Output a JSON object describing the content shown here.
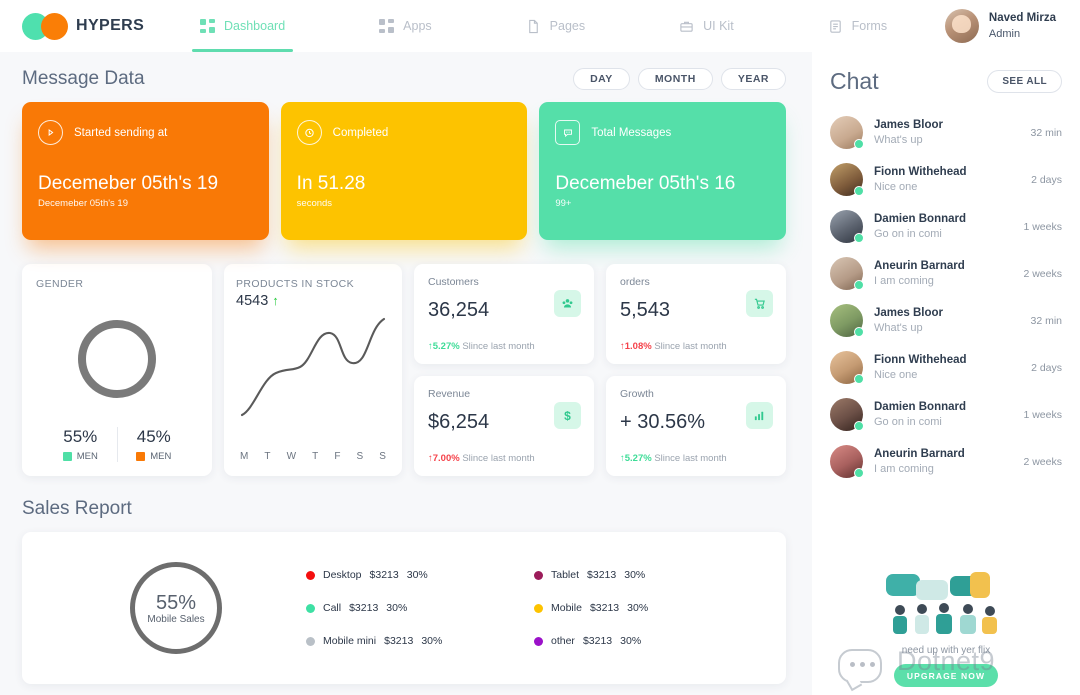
{
  "brand": {
    "name": "HYPERS"
  },
  "nav": {
    "items": [
      {
        "label": "Dashboard",
        "icon": "grid-icon",
        "active": true
      },
      {
        "label": "Apps",
        "icon": "apps-grid-icon",
        "active": false
      },
      {
        "label": "Pages",
        "icon": "page-icon",
        "active": false
      },
      {
        "label": "UI Kit",
        "icon": "briefcase-icon",
        "active": false
      },
      {
        "label": "Forms",
        "icon": "form-icon",
        "active": false
      }
    ]
  },
  "profile": {
    "name": "Naved Mirza",
    "role": "Admin"
  },
  "message_data": {
    "title": "Message Data",
    "range_buttons": [
      "DAY",
      "MONTH",
      "YEAR"
    ],
    "cards": [
      {
        "label": "Started sending at",
        "icon": "play-circle-icon",
        "value": "Decemeber 05th's 19",
        "sub": "Decemeber 05th's 19",
        "color": "#f97906"
      },
      {
        "label": "Completed",
        "icon": "clock-rewind-icon",
        "value": "In 51.28",
        "sub": "seconds",
        "color": "#fdc300"
      },
      {
        "label": "Total Messages",
        "icon": "chat-bubble-icon",
        "value": "Decemeber 05th's 16",
        "sub": "99+",
        "color": "#55dfa9"
      }
    ]
  },
  "gender": {
    "caption": "GENDER",
    "segments": [
      {
        "pct": "55%",
        "label": "MEN",
        "color": "#4fdfa6"
      },
      {
        "pct": "45%",
        "label": "MEN",
        "color": "#f97906"
      }
    ]
  },
  "stock": {
    "caption": "PRODUCTS IN STOCK",
    "value": "4543",
    "arrow": "↑",
    "days": [
      "M",
      "T",
      "W",
      "T",
      "F",
      "S",
      "S"
    ]
  },
  "kpis": [
    {
      "label": "Customers",
      "value": "36,254",
      "delta": "5.27%",
      "delta_dir": "up",
      "delta_color": "green",
      "note": "Slince last month",
      "icon": "users-icon"
    },
    {
      "label": "orders",
      "value": "5,543",
      "delta": "1.08%",
      "delta_dir": "up",
      "delta_color": "red",
      "note": "Slince last month",
      "icon": "cart-icon"
    },
    {
      "label": "Revenue",
      "value": "$6,254",
      "delta": "7.00%",
      "delta_dir": "up",
      "delta_color": "red",
      "note": "Slince last month",
      "icon": "dollar-icon"
    },
    {
      "label": "Growth",
      "value": "+ 30.56%",
      "delta": "5.27%",
      "delta_dir": "up",
      "delta_color": "green",
      "note": "Slince last month",
      "icon": "bar-chart-icon"
    }
  ],
  "sales_report": {
    "title": "Sales Report",
    "center_pct": "55%",
    "center_label": "Mobile Sales"
  },
  "chart_data": {
    "type": "pie",
    "title": "Sales Report",
    "legend_position": "right",
    "categories": [
      "Desktop",
      "Call",
      "Mobile mini",
      "Tablet",
      "Mobile",
      "other"
    ],
    "values": [
      30,
      30,
      30,
      30,
      30,
      30
    ],
    "amounts": [
      "$3213",
      "$3213",
      "$3213",
      "$3213",
      "$3213",
      "$3213"
    ],
    "percent_labels": [
      "30%",
      "30%",
      "30%",
      "30%",
      "30%",
      "30%"
    ],
    "colors": [
      "#f40f0f",
      "#3ee0a4",
      "#b9c0c7",
      "#9c1c5a",
      "#fdc300",
      "#9b11c9"
    ],
    "center_value": "55%",
    "center_label": "Mobile Sales"
  },
  "sparkline": {
    "type": "line",
    "title": "PRODUCTS IN STOCK",
    "x": [
      "M",
      "T",
      "W",
      "T",
      "F",
      "S",
      "S"
    ],
    "values": [
      8,
      34,
      48,
      52,
      72,
      60,
      62,
      95
    ],
    "ylim": [
      0,
      100
    ],
    "grid": false,
    "color": "#5a5a5a"
  },
  "chat": {
    "title": "Chat",
    "see_all": "SEE ALL",
    "items": [
      {
        "name": "James Bloor",
        "message": "What's up",
        "time": "32 min",
        "online": true,
        "avatar_tone": "#c8a98f"
      },
      {
        "name": "Fionn Withehead",
        "message": "Nice one",
        "time": "2 days",
        "online": true,
        "avatar_tone": "#8a6a4a"
      },
      {
        "name": "Damien Bonnard",
        "message": "Go on in comi",
        "time": "1 weeks",
        "online": true,
        "avatar_tone": "#5d6470"
      },
      {
        "name": "Aneurin Barnard",
        "message": "I am coming",
        "time": "2 weeks",
        "online": true,
        "avatar_tone": "#b49a86"
      },
      {
        "name": "James Bloor",
        "message": "What's up",
        "time": "32 min",
        "online": true,
        "avatar_tone": "#7e9a63"
      },
      {
        "name": "Fionn Withehead",
        "message": "Nice one",
        "time": "2 days",
        "online": true,
        "avatar_tone": "#c49a72"
      },
      {
        "name": "Damien Bonnard",
        "message": "Go on in comi",
        "time": "1 weeks",
        "online": true,
        "avatar_tone": "#6b4f46"
      },
      {
        "name": "Aneurin Barnard",
        "message": "I am coming",
        "time": "2 weeks",
        "online": true,
        "avatar_tone": "#a8605e"
      }
    ]
  },
  "promo": {
    "text_line1": "need up with",
    "text_line2": "yer flix",
    "button": "UPGRAGE NOW",
    "watermark": "Dotnet9"
  }
}
